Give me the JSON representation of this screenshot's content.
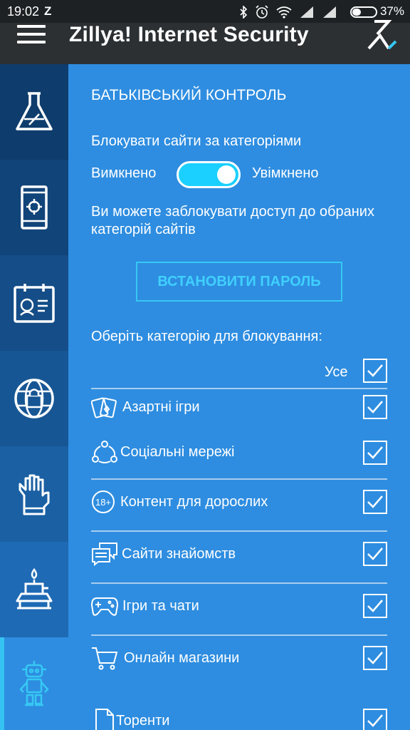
{
  "status_bar": {
    "time": "19:02",
    "notification": "Z",
    "battery": "37%",
    "battery_level": 0.37
  },
  "app_bar": {
    "title": "Zillya! Internet Security",
    "menu_icon": "hamburger-menu-icon",
    "logo_icon": "zillya-logo-icon"
  },
  "sidebar": {
    "items": [
      {
        "icon": "flask-icon",
        "active": false
      },
      {
        "icon": "phone-locate-icon",
        "active": false
      },
      {
        "icon": "id-card-icon",
        "active": false
      },
      {
        "icon": "globe-lock-icon",
        "active": false
      },
      {
        "icon": "glove-icon",
        "active": false
      },
      {
        "icon": "burner-icon",
        "active": false
      },
      {
        "icon": "robot-icon",
        "active": true
      }
    ]
  },
  "content": {
    "title": "БАТЬКІВСЬКИЙ КОНТРОЛЬ",
    "block_label": "Блокувати сайти за категоріями",
    "toggle_off_label": "Вимкнено",
    "toggle_on_label": "Увімкнено",
    "toggle_enabled": true,
    "description": "Ви можете заблокувати доступ до обраних категорій сайтів",
    "password_button": "ВСТАНОВИТИ ПАРОЛЬ",
    "choose_label": "Оберіть категорію для блокування:",
    "all_label": "Усе",
    "all_checked": true,
    "categories": [
      {
        "label": "Азартні ігри",
        "icon": "cards-icon",
        "checked": true
      },
      {
        "label": "Соціальні мережі",
        "icon": "social-network-icon",
        "checked": true
      },
      {
        "label": "Контент для дорослих",
        "icon": "adult-18-icon",
        "checked": true
      },
      {
        "label": "Сайти знайомств",
        "icon": "chat-bubbles-icon",
        "checked": true
      },
      {
        "label": "Ігри та чати",
        "icon": "gamepad-icon",
        "checked": true
      },
      {
        "label": "Онлайн магазини",
        "icon": "shopping-cart-icon",
        "checked": true
      },
      {
        "label": "Торенти",
        "icon": "file-icon",
        "checked": true
      }
    ]
  },
  "colors": {
    "content_bg": "#2e8de0",
    "app_bar": "#2c3033",
    "status_bar": "#1d2124",
    "accent": "#36c8f3",
    "sidebar_shades": [
      "#0e3c6c",
      "#114479",
      "#144d87",
      "#175694",
      "#1a60a3",
      "#1e6ab4",
      "#2e8de0"
    ]
  }
}
